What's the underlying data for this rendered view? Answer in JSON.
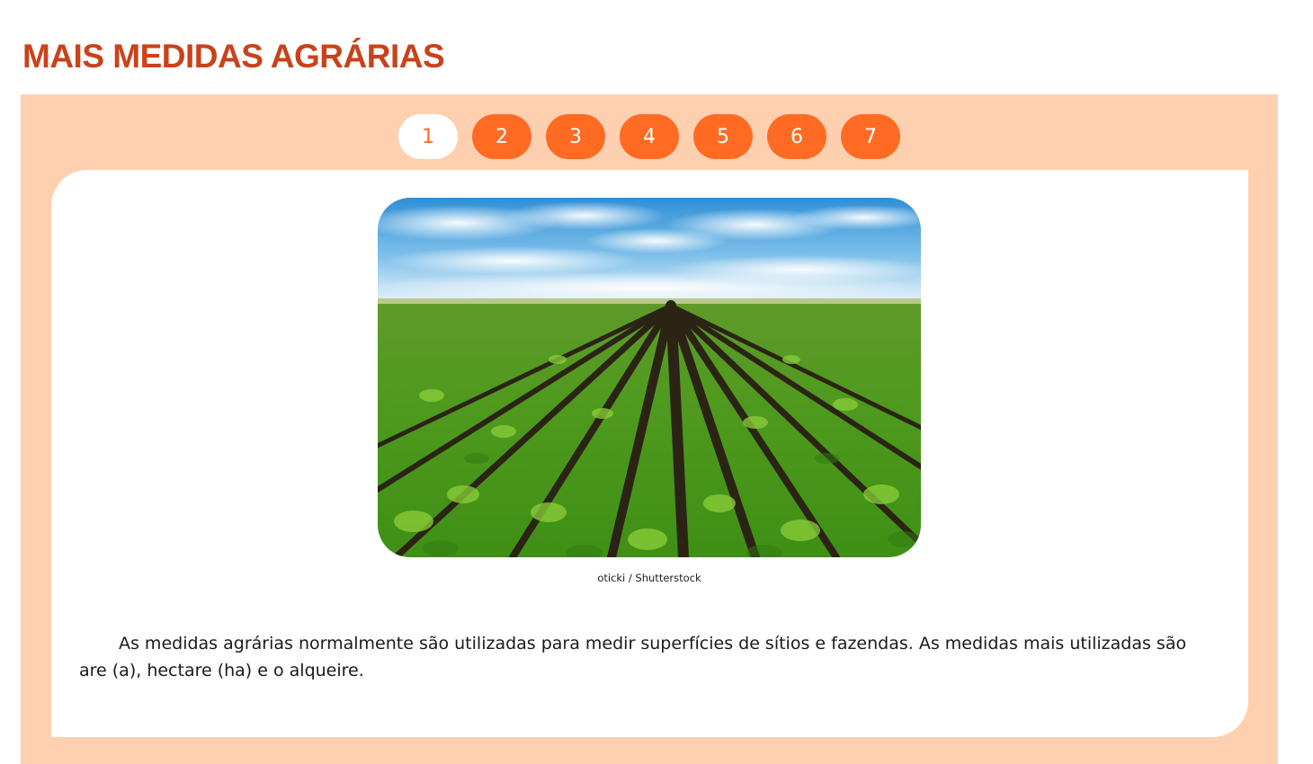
{
  "page": {
    "title": "MAIS MEDIDAS AGRÁRIAS"
  },
  "pager": {
    "pages": [
      "1",
      "2",
      "3",
      "4",
      "5",
      "6",
      "7"
    ],
    "active": "1"
  },
  "content": {
    "image_credit": "oticki / Shutterstock",
    "paragraph": "As medidas agrárias normalmente são utilizadas para medir superfícies de sítios e fazendas. As medidas mais utilizadas são are (a), hectare (ha) e o alqueire."
  },
  "colors": {
    "title": "#c8431b",
    "panel": "#ffd0b0",
    "button": "#ff6b22",
    "button_active_bg": "#ffffff"
  }
}
